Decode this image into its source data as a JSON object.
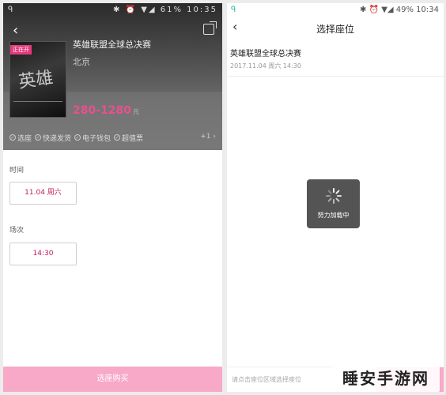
{
  "left": {
    "status": {
      "indicator": "ᑫ",
      "icons": "✱ ⏰ ▼◢ 61% 10:35"
    },
    "poster_tag": "正在开",
    "poster_art": "英雄",
    "event_title": "英雄联盟全球总决赛",
    "city": "北京",
    "price": "280-1280",
    "price_unit": "元",
    "features": [
      "选座",
      "快递发货",
      "电子钱包",
      "超值票"
    ],
    "features_more": "+1 ›",
    "time_label": "时间",
    "date_option": "11.04 周六",
    "session_label": "场次",
    "session_option": "14:30",
    "buy_button": "选座购买"
  },
  "right": {
    "status": {
      "indicator": "ᑫ",
      "icons": "✱ ⏰ ▼◢ 49% 10:34"
    },
    "title": "选择座位",
    "event_title": "英雄联盟全球总决赛",
    "event_date": "2017.11.04 周六  14:30",
    "loading_text": "努力加载中",
    "hint": "请点击座位区域选择座位"
  },
  "watermark": "睡安手游网",
  "colors": {
    "accent": "#e8508e",
    "button": "#f7a9c7",
    "text_accent": "#c2185b"
  }
}
